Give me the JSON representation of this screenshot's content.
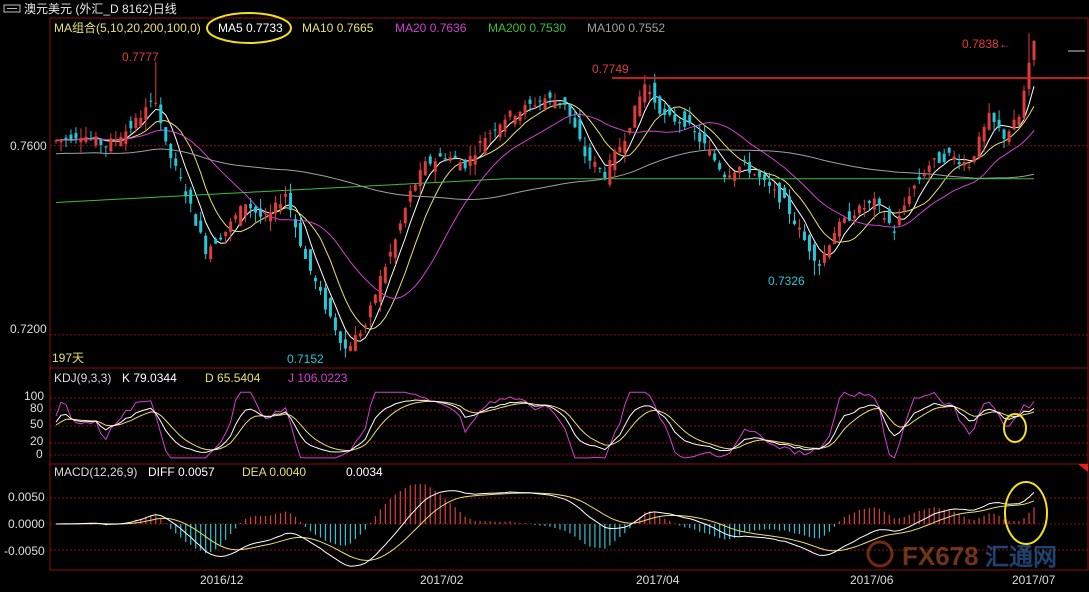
{
  "window": {
    "title": "澳元美元 (外汇_D 8162)日线",
    "title_icon": "window-icon"
  },
  "colors": {
    "up": "#e03c3c",
    "down": "#25c8d8",
    "ma5": "#ffffff",
    "ma10": "#e8e070",
    "ma20": "#d040d0",
    "ma200": "#38c038",
    "ma100": "#a0a0a0",
    "grid": "#8a1010",
    "highlight_line": "#e02020",
    "annotation_circle": "#f0e020"
  },
  "main_panel": {
    "ma_header": "MA组合(5,10,20,200,100,0)",
    "legend": [
      {
        "label": "MA5",
        "value": "0.7733",
        "color": "#ffffff"
      },
      {
        "label": "MA10",
        "value": "0.7665",
        "color": "#e8e070"
      },
      {
        "label": "MA20",
        "value": "0.7636",
        "color": "#d040d0"
      },
      {
        "label": "MA200",
        "value": "0.7530",
        "color": "#38c038"
      },
      {
        "label": "MA100",
        "value": "0.7552",
        "color": "#a0a0a0"
      }
    ],
    "y_ticks": [
      "0.7600",
      "0.7200"
    ],
    "bar_count": "197天",
    "price_labels": [
      "0.7777",
      "0.7749",
      "0.7838",
      "0.7326",
      "0.7152"
    ],
    "current_marker": "0.7838←"
  },
  "kdj_panel": {
    "header": "KDJ(9,3,3)",
    "k_label": "K",
    "k_value": "79.0344",
    "d_label": "D",
    "d_value": "65.5404",
    "j_label": "J",
    "j_value": "106.0223",
    "y_ticks": [
      "100",
      "80",
      "50",
      "20",
      "0"
    ]
  },
  "macd_panel": {
    "header": "MACD(12,26,9)",
    "diff_label": "DIFF",
    "diff_value": "0.0057",
    "dea_label": "DEA",
    "dea_value": "0.0040",
    "macd_value": "0.0034",
    "y_ticks": [
      "0.0050",
      "0.0000",
      "-0.0050"
    ]
  },
  "x_axis": {
    "ticks": [
      "2016/12",
      "2017/02",
      "2017/04",
      "2017/06",
      "2017/07"
    ]
  },
  "watermark": {
    "text": "FX678",
    "text2": "汇通网"
  },
  "chart_data": {
    "type": "candlestick",
    "title": "澳元美元 (外汇_D 8162)日线",
    "bars": 197,
    "ylim": [
      0.713,
      0.787
    ],
    "key_points": [
      {
        "label": "0.7777",
        "value": 0.7777,
        "bar": 20
      },
      {
        "label": "0.7152",
        "value": 0.7152,
        "bar": 58
      },
      {
        "label": "0.7749",
        "value": 0.7749,
        "bar": 118
      },
      {
        "label": "0.7326",
        "value": 0.7326,
        "bar": 152
      },
      {
        "label": "0.7838",
        "value": 0.7838,
        "bar": 195
      }
    ],
    "close_path": [
      [
        0,
        0.761
      ],
      [
        5,
        0.7625
      ],
      [
        10,
        0.76
      ],
      [
        15,
        0.764
      ],
      [
        20,
        0.77
      ],
      [
        22,
        0.76
      ],
      [
        26,
        0.75
      ],
      [
        30,
        0.738
      ],
      [
        34,
        0.742
      ],
      [
        38,
        0.748
      ],
      [
        42,
        0.744
      ],
      [
        46,
        0.75
      ],
      [
        50,
        0.736
      ],
      [
        54,
        0.726
      ],
      [
        58,
        0.717
      ],
      [
        62,
        0.722
      ],
      [
        65,
        0.732
      ],
      [
        68,
        0.74
      ],
      [
        71,
        0.75
      ],
      [
        74,
        0.756
      ],
      [
        78,
        0.758
      ],
      [
        82,
        0.756
      ],
      [
        86,
        0.762
      ],
      [
        90,
        0.766
      ],
      [
        94,
        0.768
      ],
      [
        98,
        0.77
      ],
      [
        102,
        0.769
      ],
      [
        106,
        0.758
      ],
      [
        110,
        0.754
      ],
      [
        114,
        0.762
      ],
      [
        118,
        0.773
      ],
      [
        122,
        0.766
      ],
      [
        126,
        0.765
      ],
      [
        130,
        0.76
      ],
      [
        134,
        0.754
      ],
      [
        138,
        0.756
      ],
      [
        142,
        0.752
      ],
      [
        146,
        0.748
      ],
      [
        150,
        0.74
      ],
      [
        153,
        0.735
      ],
      [
        156,
        0.742
      ],
      [
        160,
        0.746
      ],
      [
        164,
        0.748
      ],
      [
        168,
        0.742
      ],
      [
        171,
        0.75
      ],
      [
        175,
        0.756
      ],
      [
        179,
        0.758
      ],
      [
        183,
        0.756
      ],
      [
        187,
        0.766
      ],
      [
        190,
        0.762
      ],
      [
        193,
        0.766
      ],
      [
        196,
        0.782
      ]
    ],
    "ma_series": [
      {
        "name": "MA5",
        "value": 0.7733
      },
      {
        "name": "MA10",
        "value": 0.7665
      },
      {
        "name": "MA20",
        "value": 0.7636
      },
      {
        "name": "MA200",
        "value": 0.753
      },
      {
        "name": "MA100",
        "value": 0.7552
      }
    ],
    "kdj": {
      "K": 79.0344,
      "D": 65.5404,
      "J": 106.0223
    },
    "macd": {
      "DIFF": 0.0057,
      "DEA": 0.004,
      "MACD": 0.0034
    }
  }
}
